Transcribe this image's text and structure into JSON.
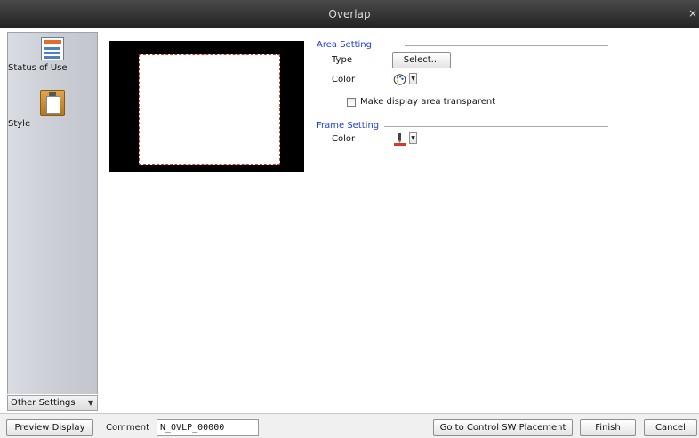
{
  "window": {
    "title": "Overlap",
    "close_glyph": "×"
  },
  "sidebar": {
    "items": [
      {
        "label": "Status of Use",
        "icon": "status-of-use-icon"
      },
      {
        "label": "Style",
        "icon": "style-icon"
      }
    ],
    "other_settings_label": "Other Settings"
  },
  "area_setting": {
    "title": "Area Setting",
    "type_label": "Type",
    "select_button": "Select...",
    "color_label": "Color",
    "color_icon": "palette-icon",
    "transparent_label": "Make display area transparent",
    "transparent_checked": false
  },
  "frame_setting": {
    "title": "Frame Setting",
    "color_label": "Color",
    "color_icon": "pen-color-icon",
    "frame_color": "#d4392e"
  },
  "footer": {
    "preview_display": "Preview Display",
    "comment_label": "Comment",
    "comment_value": "N_OVLP_00000",
    "go_to_button": "Go to Control SW Placement",
    "finish_button": "Finish",
    "cancel_button": "Cancel"
  }
}
